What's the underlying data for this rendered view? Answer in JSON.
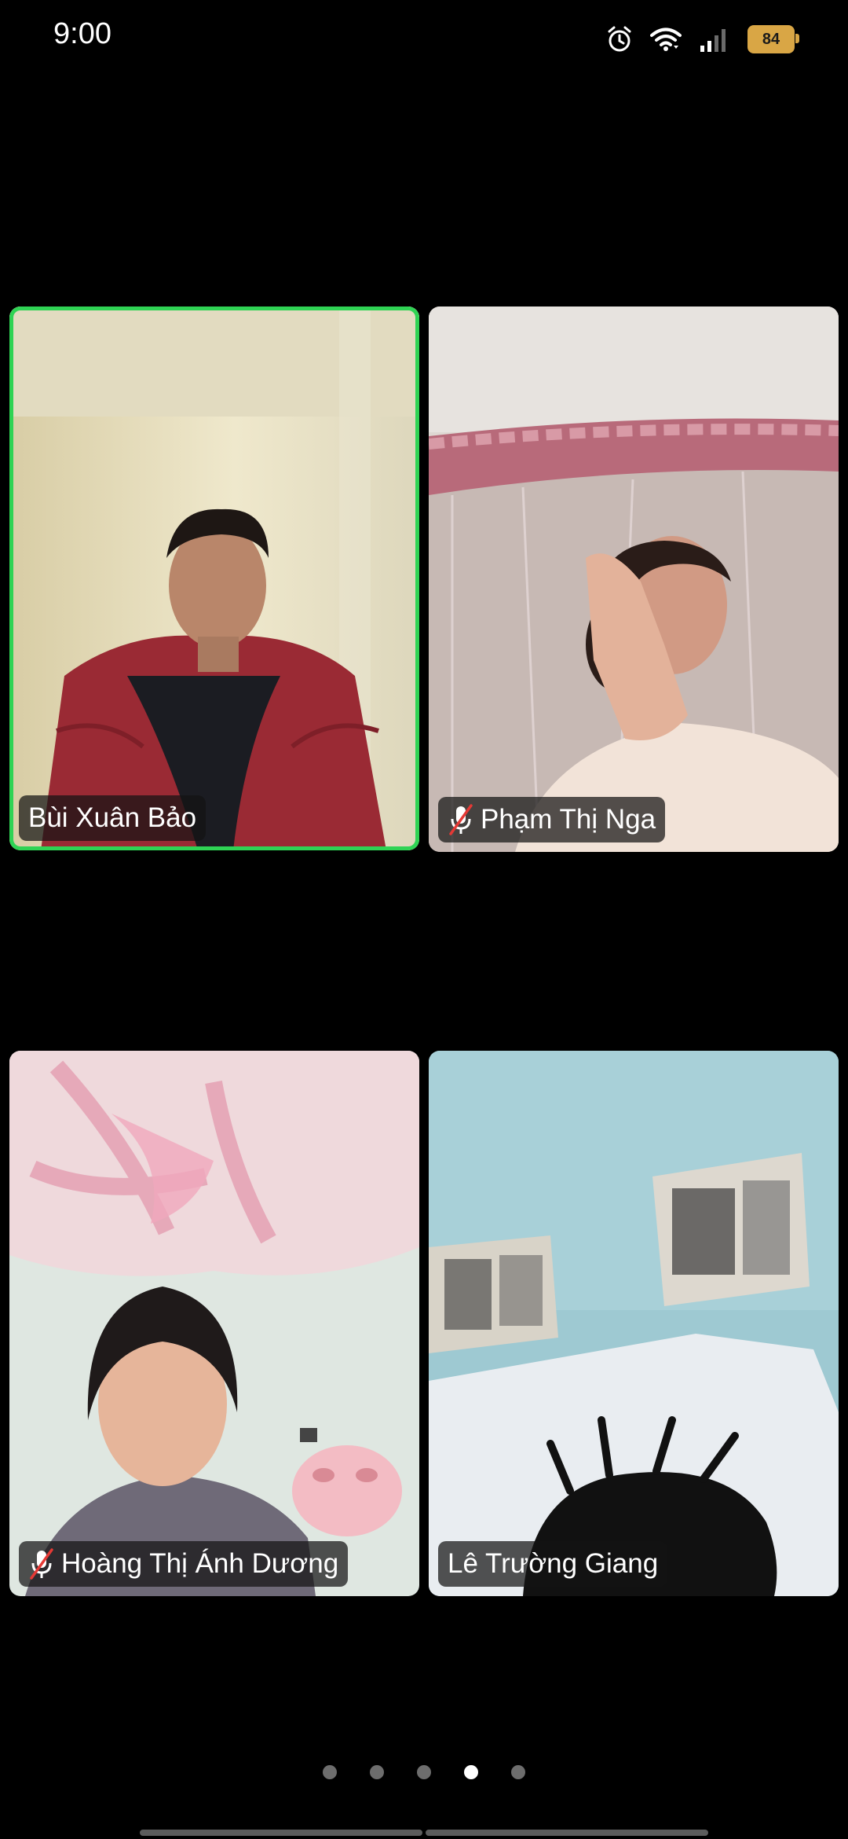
{
  "status_bar": {
    "time": "9:00",
    "battery": "84",
    "icons": [
      "alarm-icon",
      "wifi-icon",
      "cellular-signal-icon",
      "battery-icon"
    ]
  },
  "participants": [
    {
      "name": "Bùi Xuân Bảo",
      "muted": false,
      "active_speaker": true
    },
    {
      "name": "Phạm Thị Nga",
      "muted": true,
      "active_speaker": false
    },
    {
      "name": "Hoàng Thị Ánh Dương",
      "muted": true,
      "active_speaker": false
    },
    {
      "name": "Lê Trường Giang",
      "muted": false,
      "active_speaker": false
    }
  ],
  "pagination": {
    "total_pages": 5,
    "current_page": 4
  },
  "colors": {
    "active_speaker_border": "#2fd354",
    "label_background": "#141414",
    "battery": "#d9a645",
    "muted_slash": "#e53935"
  }
}
